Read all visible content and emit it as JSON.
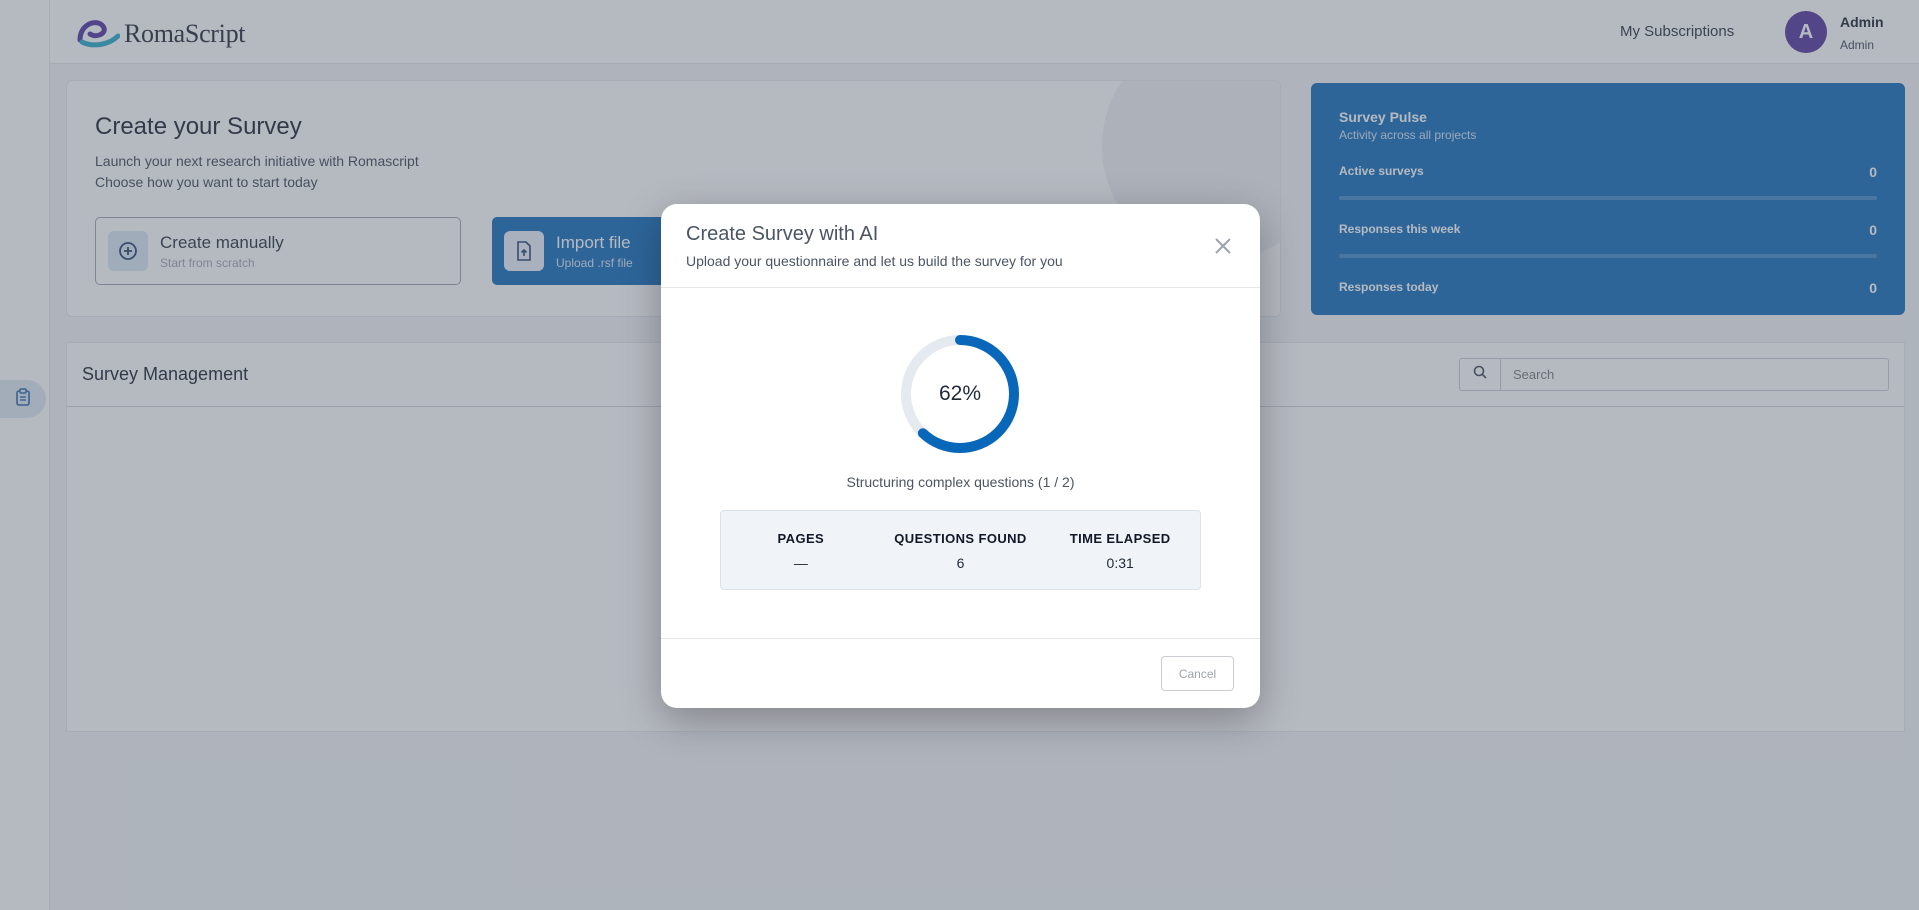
{
  "app": {
    "name": "RomaScript"
  },
  "header": {
    "subscriptions_label": "My Subscriptions",
    "user": {
      "initial": "A",
      "name": "Admin",
      "role": "Admin"
    }
  },
  "create_card": {
    "title": "Create your Survey",
    "subtitle_line1": "Launch your next research initiative with Romascript",
    "subtitle_line2": "Choose how you want to start today",
    "options": [
      {
        "label": "Create manually",
        "hint": "Start from scratch",
        "icon": "plus-circle-icon"
      },
      {
        "label": "Import file",
        "hint": "Upload .rsf file",
        "icon": "file-upload-icon"
      }
    ]
  },
  "pulse": {
    "title": "Survey Pulse",
    "subtitle": "Activity across all projects",
    "rows": [
      {
        "label": "Active surveys",
        "value": "0"
      },
      {
        "label": "Responses this week",
        "value": "0"
      },
      {
        "label": "Responses today",
        "value": "0"
      }
    ]
  },
  "management": {
    "title": "Survey Management",
    "search_placeholder": "Search"
  },
  "modal": {
    "title": "Create Survey with AI",
    "subtitle": "Upload your questionnaire and let us build the survey for you",
    "progress_percent": 62,
    "progress_label": "62%",
    "status": "Structuring complex questions (1 / 2)",
    "stats": [
      {
        "label": "PAGES",
        "value": "—"
      },
      {
        "label": "QUESTIONS FOUND",
        "value": "6"
      },
      {
        "label": "TIME ELAPSED",
        "value": "0:31"
      }
    ],
    "cancel_label": "Cancel"
  },
  "colors": {
    "brand_blue": "#0867b8",
    "avatar_purple": "#4b2d9a",
    "progress_track": "#e5e9f0"
  }
}
